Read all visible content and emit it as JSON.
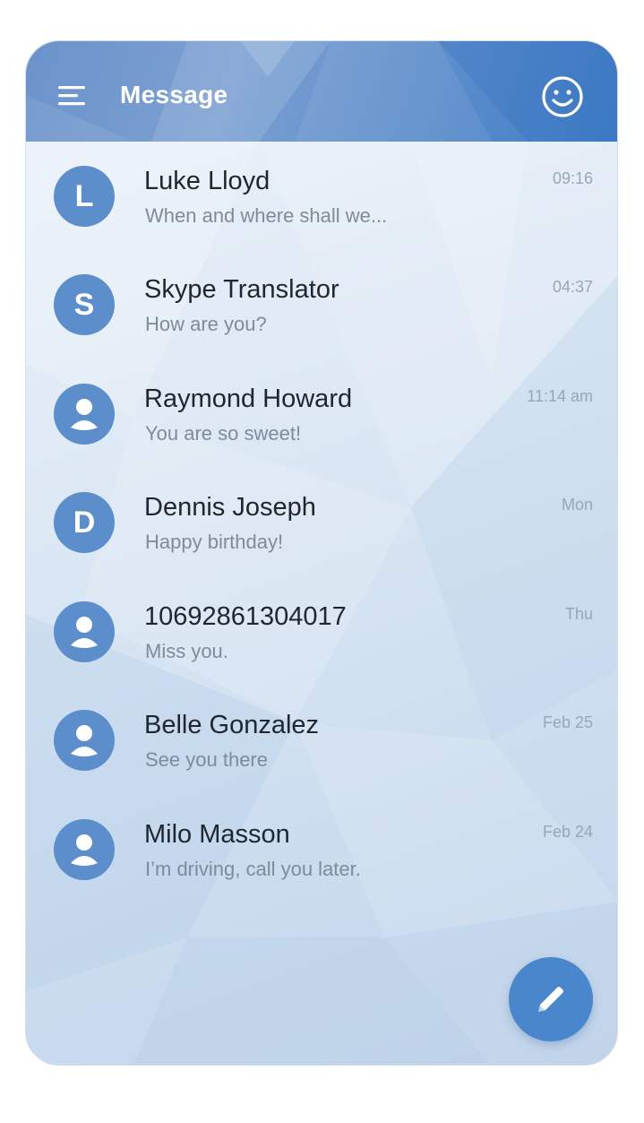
{
  "header": {
    "title": "Message",
    "menu_icon": "hamburger-menu-icon",
    "right_icon": "smiley-face-icon",
    "color": "#6b93cb"
  },
  "conversations": [
    {
      "name": "Luke Lloyd",
      "preview": "When and where shall we...",
      "time": "09:16",
      "avatar_type": "letter",
      "avatar_letter": "L"
    },
    {
      "name": "Skype Translator",
      "preview": "How are you?",
      "time": "04:37",
      "avatar_type": "letter",
      "avatar_letter": "S"
    },
    {
      "name": "Raymond Howard",
      "preview": "You are so sweet!",
      "time": "11:14 am",
      "avatar_type": "person-icon",
      "avatar_letter": ""
    },
    {
      "name": "Dennis Joseph",
      "preview": "Happy birthday!",
      "time": "Mon",
      "avatar_type": "letter",
      "avatar_letter": "D"
    },
    {
      "name": "10692861304017",
      "preview": "Miss you.",
      "time": "Thu",
      "avatar_type": "person-icon",
      "avatar_letter": ""
    },
    {
      "name": "Belle Gonzalez",
      "preview": "See you there",
      "time": "Feb 25",
      "avatar_type": "person-icon",
      "avatar_letter": ""
    },
    {
      "name": "Milo Masson",
      "preview": "I’m driving, call you later.",
      "time": "Feb 24",
      "avatar_type": "person-icon",
      "avatar_letter": ""
    }
  ],
  "fab": {
    "icon": "pencil-compose-icon",
    "color": "#4a86cc"
  },
  "colors": {
    "avatar": "#5c8ecc",
    "name_text": "#1f2630",
    "preview_text": "#7e8b99",
    "time_text": "#9aa6b3"
  }
}
